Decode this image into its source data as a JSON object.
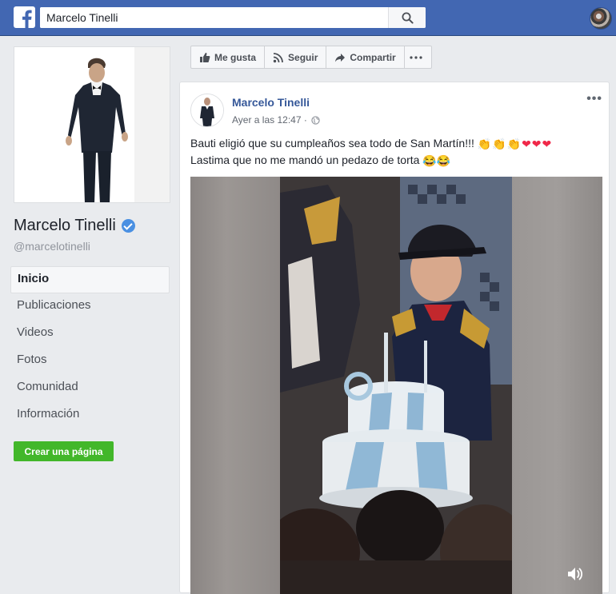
{
  "topbar": {
    "search_value": "Marcelo Tinelli",
    "icons": [
      "facebook-logo-icon",
      "search-icon"
    ]
  },
  "page": {
    "name": "Marcelo Tinelli",
    "handle": "@marcelotinelli",
    "verified": true
  },
  "nav": {
    "items": [
      "Inicio",
      "Publicaciones",
      "Videos",
      "Fotos",
      "Comunidad",
      "Información"
    ],
    "active_index": 0
  },
  "create_page_label": "Crear una página",
  "actions": {
    "like": "Me gusta",
    "follow": "Seguir",
    "share": "Compartir"
  },
  "post": {
    "author": "Marcelo Tinelli",
    "time": "Ayer a las 12:47 ·",
    "line1": "Bauti eligió que su cumpleaños sea todo de San Martín!!!",
    "line1_emojis": "👏👏👏❤❤❤",
    "line2": "Lastima que no me mandó un pedazo de torta",
    "line2_emojis": "😂😂"
  },
  "colors": {
    "brand": "#4267b2",
    "link": "#365899",
    "create_button": "#42b72a"
  }
}
